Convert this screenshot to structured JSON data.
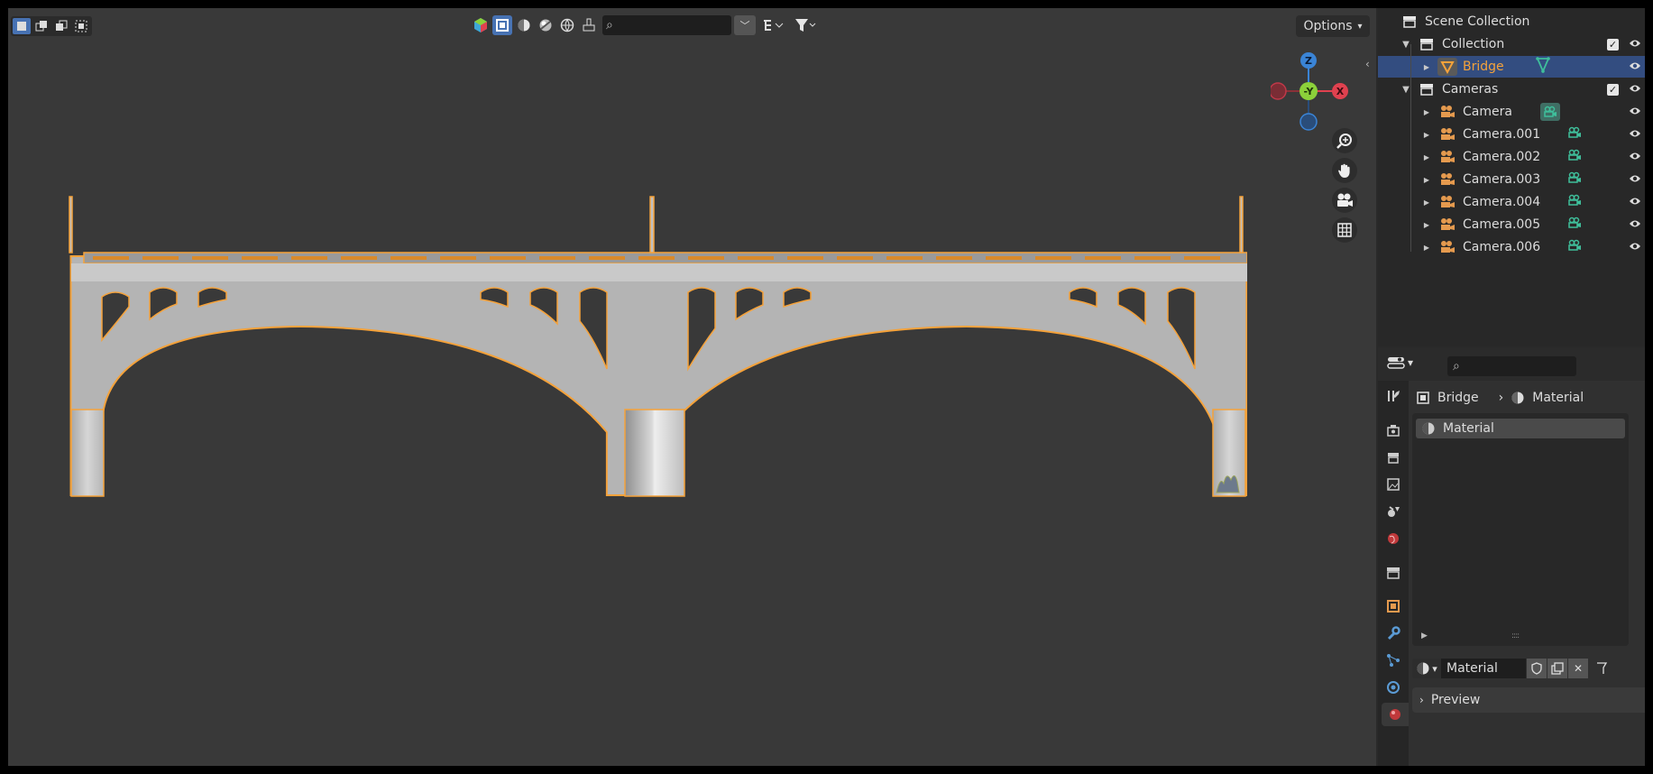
{
  "viewport": {
    "options_label": "Options",
    "search_placeholder": "",
    "gizmo": {
      "z": "Z",
      "neg_y": "-Y",
      "x": "X"
    }
  },
  "outliner": {
    "rows": [
      {
        "label": "Scene Collection"
      },
      {
        "label": "Collection"
      },
      {
        "label": "Bridge"
      },
      {
        "label": "Cameras"
      },
      {
        "label": "Camera"
      },
      {
        "label": "Camera.001"
      },
      {
        "label": "Camera.002"
      },
      {
        "label": "Camera.003"
      },
      {
        "label": "Camera.004"
      },
      {
        "label": "Camera.005"
      },
      {
        "label": "Camera.006"
      }
    ]
  },
  "properties": {
    "breadcrumb": {
      "object": "Bridge",
      "material": "Material"
    },
    "slots": [
      {
        "label": "Material"
      }
    ],
    "material_name": "Material",
    "preview_label": "Preview"
  },
  "colors": {
    "selection_outline": "#f5a23a",
    "selected_row": "#334d80",
    "accent_blue": "#4772b3",
    "axis_x": "#e0414f",
    "axis_y": "#8cd13a",
    "axis_z": "#3a84d6",
    "camera_icon": "#e59a4e",
    "camera_data_icon": "#3fbf9b"
  }
}
